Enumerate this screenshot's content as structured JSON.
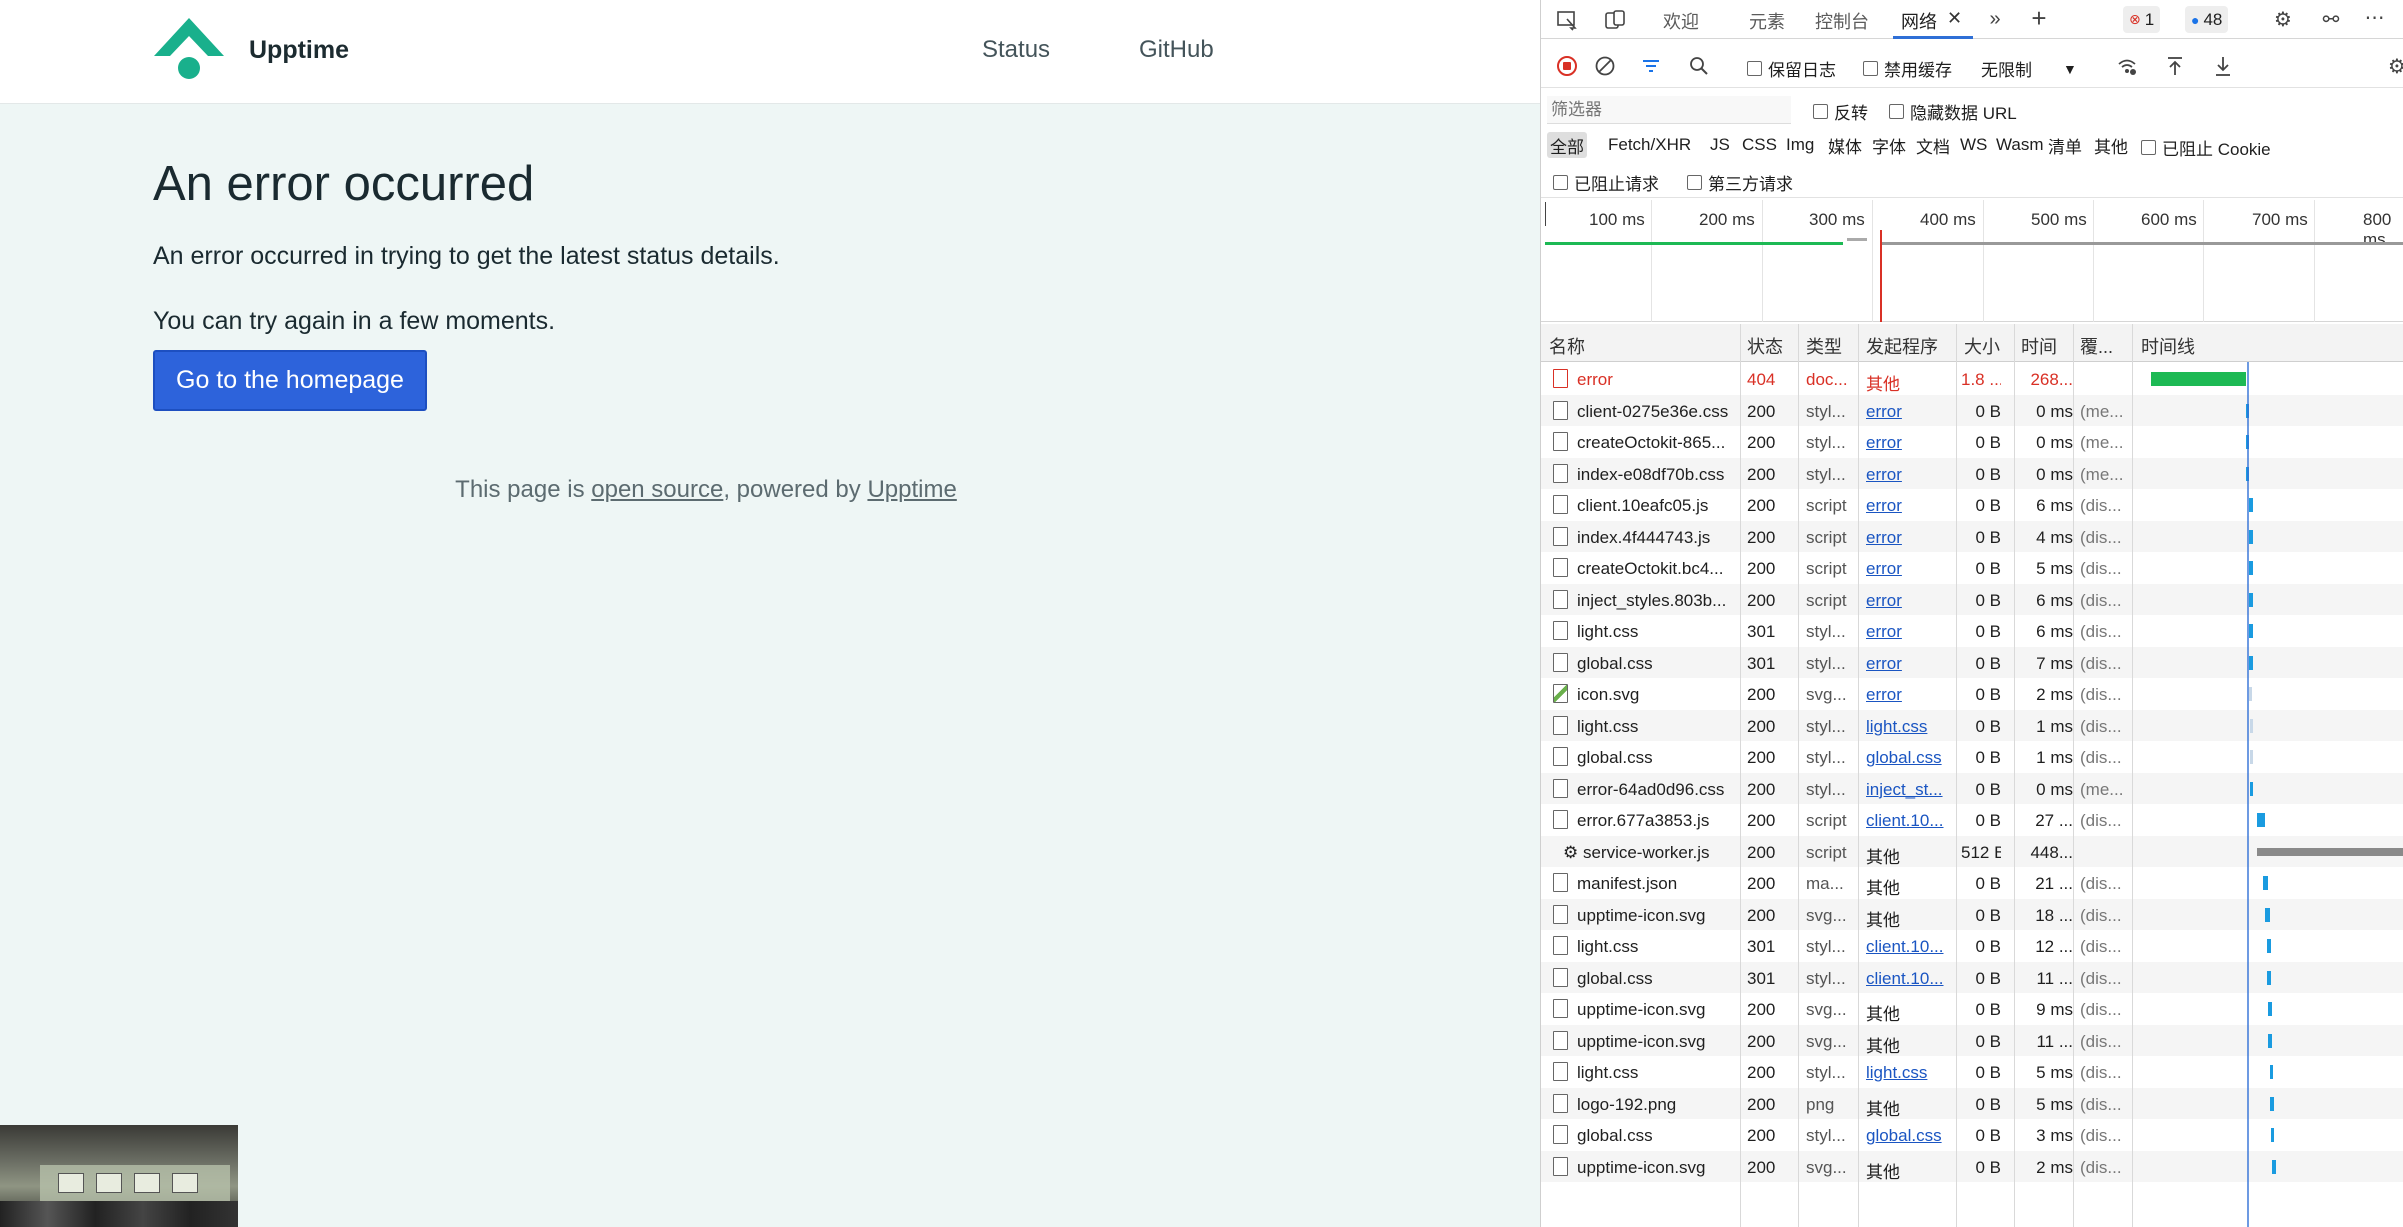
{
  "site": {
    "brand": "Upptime",
    "brand_color": "#19b08c",
    "nav": {
      "status": "Status",
      "github": "GitHub"
    },
    "error_title": "An error occurred",
    "error_desc": "An error occurred in trying to get the latest status details.",
    "error_retry": "You can try again in a few moments.",
    "home_button": "Go to the homepage",
    "footer": {
      "prefix": "This page is ",
      "open_source": "open source",
      "middle": ", powered by ",
      "upptime": "Upptime"
    }
  },
  "devtools": {
    "tabs": {
      "welcome": "欢迎",
      "elements": "元素",
      "console": "控制台",
      "network": "网络"
    },
    "error_count": "1",
    "message_count": "48",
    "toolbar": {
      "preserve_log": "保留日志",
      "disable_cache": "禁用缓存",
      "throttle": "无限制"
    },
    "filter": {
      "placeholder": "筛选器",
      "invert": "反转",
      "hide_data_urls": "隐藏数据 URL"
    },
    "types": {
      "all": "全部",
      "fetch": "Fetch/XHR",
      "js": "JS",
      "css": "CSS",
      "img": "Img",
      "media": "媒体",
      "font": "字体",
      "doc": "文档",
      "ws": "WS",
      "wasm": "Wasm",
      "manifest": "清单",
      "other": "其他",
      "blocked_cookies": "已阻止 Cookie"
    },
    "types2": {
      "blocked_requests": "已阻止请求",
      "third_party": "第三方请求"
    },
    "ticks": [
      "100 ms",
      "200 ms",
      "300 ms",
      "400 ms",
      "500 ms",
      "600 ms",
      "700 ms",
      "800 ms"
    ],
    "columns": {
      "name": "名称",
      "status": "状态",
      "type": "类型",
      "initiator": "发起程序",
      "size": "大小",
      "time": "时间",
      "coverage": "覆...",
      "waterfall": "时间线"
    },
    "accent": "#1a73e8",
    "error_color": "#d93025",
    "rows": [
      {
        "name": "error",
        "status": "404",
        "type": "doc...",
        "initiator": "其他",
        "size": "1.8 ...",
        "time": "268...",
        "cover": "",
        "err": true,
        "link": false
      },
      {
        "name": "client-0275e36e.css",
        "status": "200",
        "type": "styl...",
        "initiator": "error",
        "size": "0 B",
        "time": "0 ms",
        "cover": "(me...",
        "link": true
      },
      {
        "name": "createOctokit-865...",
        "status": "200",
        "type": "styl...",
        "initiator": "error",
        "size": "0 B",
        "time": "0 ms",
        "cover": "(me...",
        "link": true
      },
      {
        "name": "index-e08df70b.css",
        "status": "200",
        "type": "styl...",
        "initiator": "error",
        "size": "0 B",
        "time": "0 ms",
        "cover": "(me...",
        "link": true
      },
      {
        "name": "client.10eafc05.js",
        "status": "200",
        "type": "script",
        "initiator": "error",
        "size": "0 B",
        "time": "6 ms",
        "cover": "(dis...",
        "link": true
      },
      {
        "name": "index.4f444743.js",
        "status": "200",
        "type": "script",
        "initiator": "error",
        "size": "0 B",
        "time": "4 ms",
        "cover": "(dis...",
        "link": true
      },
      {
        "name": "createOctokit.bc4...",
        "status": "200",
        "type": "script",
        "initiator": "error",
        "size": "0 B",
        "time": "5 ms",
        "cover": "(dis...",
        "link": true
      },
      {
        "name": "inject_styles.803b...",
        "status": "200",
        "type": "script",
        "initiator": "error",
        "size": "0 B",
        "time": "6 ms",
        "cover": "(dis...",
        "link": true
      },
      {
        "name": "light.css",
        "status": "301",
        "type": "styl...",
        "initiator": "error",
        "size": "0 B",
        "time": "6 ms",
        "cover": "(dis...",
        "link": true
      },
      {
        "name": "global.css",
        "status": "301",
        "type": "styl...",
        "initiator": "error",
        "size": "0 B",
        "time": "7 ms",
        "cover": "(dis...",
        "link": true
      },
      {
        "name": "icon.svg",
        "status": "200",
        "type": "svg...",
        "initiator": "error",
        "size": "0 B",
        "time": "2 ms",
        "cover": "(dis...",
        "link": true,
        "img": true
      },
      {
        "name": "light.css",
        "status": "200",
        "type": "styl...",
        "initiator": "light.css",
        "size": "0 B",
        "time": "1 ms",
        "cover": "(dis...",
        "link": true
      },
      {
        "name": "global.css",
        "status": "200",
        "type": "styl...",
        "initiator": "global.css",
        "size": "0 B",
        "time": "1 ms",
        "cover": "(dis...",
        "link": true
      },
      {
        "name": "error-64ad0d96.css",
        "status": "200",
        "type": "styl...",
        "initiator": "inject_st...",
        "size": "0 B",
        "time": "0 ms",
        "cover": "(me...",
        "link": true
      },
      {
        "name": "error.677a3853.js",
        "status": "200",
        "type": "script",
        "initiator": "client.10...",
        "size": "0 B",
        "time": "27 ...",
        "cover": "(dis...",
        "link": true
      },
      {
        "name": "⚙ service-worker.js",
        "status": "200",
        "type": "script",
        "initiator": "其他",
        "size": "512 B",
        "time": "448...",
        "cover": "",
        "link": false,
        "noicon": true
      },
      {
        "name": "manifest.json",
        "status": "200",
        "type": "ma...",
        "initiator": "其他",
        "size": "0 B",
        "time": "21 ...",
        "cover": "(dis...",
        "link": false
      },
      {
        "name": "upptime-icon.svg",
        "status": "200",
        "type": "svg...",
        "initiator": "其他",
        "size": "0 B",
        "time": "18 ...",
        "cover": "(dis...",
        "link": false
      },
      {
        "name": "light.css",
        "status": "301",
        "type": "styl...",
        "initiator": "client.10...",
        "size": "0 B",
        "time": "12 ...",
        "cover": "(dis...",
        "link": true
      },
      {
        "name": "global.css",
        "status": "301",
        "type": "styl...",
        "initiator": "client.10...",
        "size": "0 B",
        "time": "11 ...",
        "cover": "(dis...",
        "link": true
      },
      {
        "name": "upptime-icon.svg",
        "status": "200",
        "type": "svg...",
        "initiator": "其他",
        "size": "0 B",
        "time": "9 ms",
        "cover": "(dis...",
        "link": false
      },
      {
        "name": "upptime-icon.svg",
        "status": "200",
        "type": "svg...",
        "initiator": "其他",
        "size": "0 B",
        "time": "11 ...",
        "cover": "(dis...",
        "link": false
      },
      {
        "name": "light.css",
        "status": "200",
        "type": "styl...",
        "initiator": "light.css",
        "size": "0 B",
        "time": "5 ms",
        "cover": "(dis...",
        "link": true
      },
      {
        "name": "logo-192.png",
        "status": "200",
        "type": "png",
        "initiator": "其他",
        "size": "0 B",
        "time": "5 ms",
        "cover": "(dis...",
        "link": false
      },
      {
        "name": "global.css",
        "status": "200",
        "type": "styl...",
        "initiator": "global.css",
        "size": "0 B",
        "time": "3 ms",
        "cover": "(dis...",
        "link": true
      },
      {
        "name": "upptime-icon.svg",
        "status": "200",
        "type": "svg...",
        "initiator": "其他",
        "size": "0 B",
        "time": "2 ms",
        "cover": "(dis...",
        "link": false
      }
    ]
  }
}
